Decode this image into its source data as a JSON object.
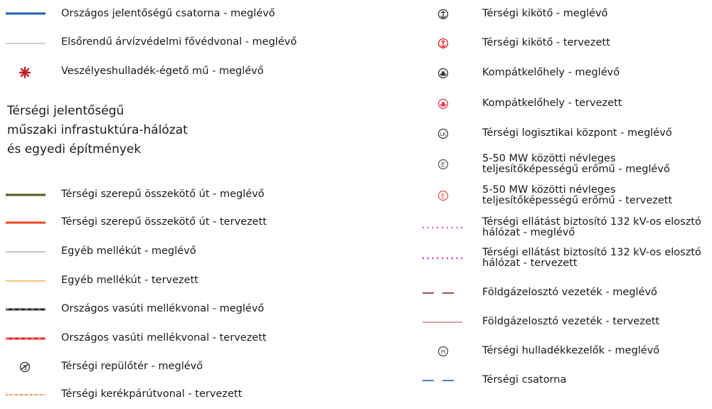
{
  "legend": {
    "left_top": [
      {
        "label": "Országos jelentőségű csatorna - meglévő",
        "symbol": "line",
        "color": "#1f5fb5"
      },
      {
        "label": "Elsőrendű árvízvédelmi fővédvonal - meglévő",
        "symbol": "thin-line",
        "color": "#9a9a9a"
      },
      {
        "label": "Veszélyeshulladék-égető mű - meglévő",
        "symbol": "asterisk",
        "color": "#c0202a"
      }
    ],
    "heading": [
      "Térségi jelentőségű",
      "műszaki infrastuktúra-hálózat",
      "és egyedi építmények"
    ],
    "left_bottom": [
      {
        "label": "Térségi szerepű összekötő út - meglévő",
        "symbol": "line",
        "color": "#4f5a1c"
      },
      {
        "label": "Térségi szerepű összekötő út - tervezett",
        "symbol": "line",
        "color": "#ef4a1e"
      },
      {
        "label": "Egyéb mellékút - meglévő",
        "symbol": "thin-line",
        "color": "#8a8a8a"
      },
      {
        "label": "Egyéb mellékút - tervezett",
        "symbol": "thin-line",
        "color": "#f0a030"
      },
      {
        "label": "Országos vasúti mellékvonal - meglévő",
        "symbol": "rail",
        "color": "#222222"
      },
      {
        "label": "Országos vasúti mellékvonal - tervezett",
        "symbol": "rail",
        "color": "#e02020"
      },
      {
        "label": "Térségi repülőtér - meglévő",
        "symbol": "airport-icon",
        "color": "#333333"
      },
      {
        "label": "Térségi kerékpárútvonal - tervezett",
        "symbol": "dotted-line",
        "color": "#e8a070"
      }
    ],
    "right": [
      {
        "label": "Térségi kikötő - meglévő",
        "symbol": "anchor-icon",
        "color": "#333333"
      },
      {
        "label": "Térségi kikötő - tervezett",
        "symbol": "anchor-icon",
        "color": "#e02020"
      },
      {
        "label": "Kompátkelőhely - meglévő",
        "symbol": "ferry-icon",
        "color": "#333333"
      },
      {
        "label": "Kompátkelőhely - tervezett",
        "symbol": "ferry-icon",
        "color": "#e04050"
      },
      {
        "label": "Térségi logisztikai központ - meglévő",
        "symbol": "lk-icon",
        "color": "#333333",
        "icon_text": "LK"
      },
      {
        "label": "5-50 MW közötti névleges teljesítőképességű erőmű  - meglévő",
        "symbol": "e-icon",
        "color": "#555555",
        "icon_text": "E"
      },
      {
        "label": "5-50 MW közötti névleges teljesítőképességű erőmű - tervezett",
        "symbol": "e-icon",
        "color": "#e05050",
        "icon_text": "E"
      },
      {
        "label": "Térségi ellátást biztosító 132 kV-os elosztó hálózat - meglévő",
        "symbol": "dotted-line",
        "color": "#d020c0"
      },
      {
        "label": "Térségi ellátást biztosító 132 kV-os elosztó hálózat - tervezett",
        "symbol": "dotted-line",
        "color": "#d020c0"
      },
      {
        "label": "Földgázelosztó vezeték - meglévő",
        "symbol": "dashed-line",
        "color": "#8a3a3a"
      },
      {
        "label": "Földgázelosztó vezeték - tervezett",
        "symbol": "thin-line",
        "color": "#c07070"
      },
      {
        "label": "Térségi hulladékkezelők - meglévő",
        "symbol": "h-icon",
        "color": "#444444",
        "icon_text": "H"
      },
      {
        "label": "Térségi csatorna",
        "symbol": "dashed-line",
        "color": "#2f6fd0"
      }
    ]
  }
}
